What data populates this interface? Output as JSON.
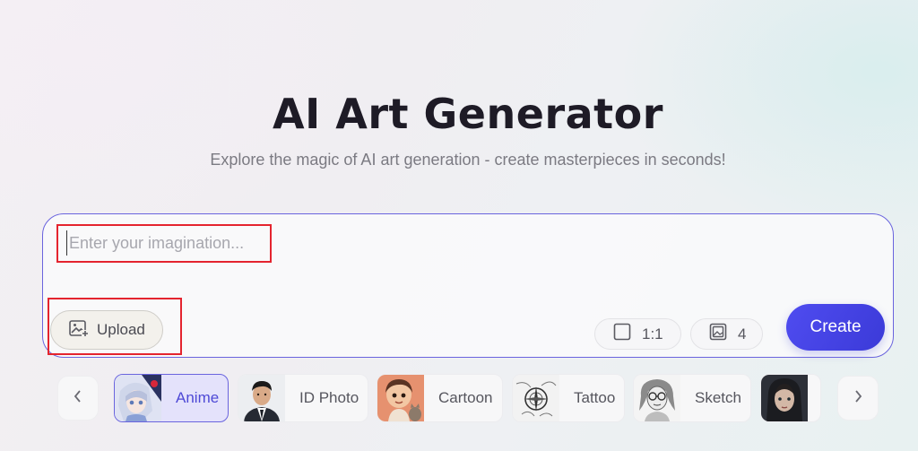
{
  "header": {
    "title": "AI Art Generator",
    "subtitle": "Explore the magic of AI art generation - create masterpieces in seconds!"
  },
  "prompt": {
    "placeholder": "Enter your imagination...",
    "value": ""
  },
  "toolbar": {
    "upload_label": "Upload",
    "ratio_value": "1:1",
    "count_value": "4",
    "create_label": "Create"
  },
  "styles": {
    "items": [
      {
        "label": "Anime",
        "active": true,
        "icon": "anime-thumbnail"
      },
      {
        "label": "ID Photo",
        "active": false,
        "icon": "id-photo-thumbnail"
      },
      {
        "label": "Cartoon",
        "active": false,
        "icon": "cartoon-thumbnail"
      },
      {
        "label": "Tattoo",
        "active": false,
        "icon": "tattoo-thumbnail"
      },
      {
        "label": "Sketch",
        "active": false,
        "icon": "sketch-thumbnail"
      },
      {
        "label": "",
        "active": false,
        "icon": "fantasy-thumbnail"
      }
    ],
    "prev_icon": "chevron-left-icon",
    "next_icon": "chevron-right-icon"
  },
  "colors": {
    "accent": "#4f4cf0",
    "highlight": "#e4242e",
    "active_label": "#4e49d6"
  }
}
